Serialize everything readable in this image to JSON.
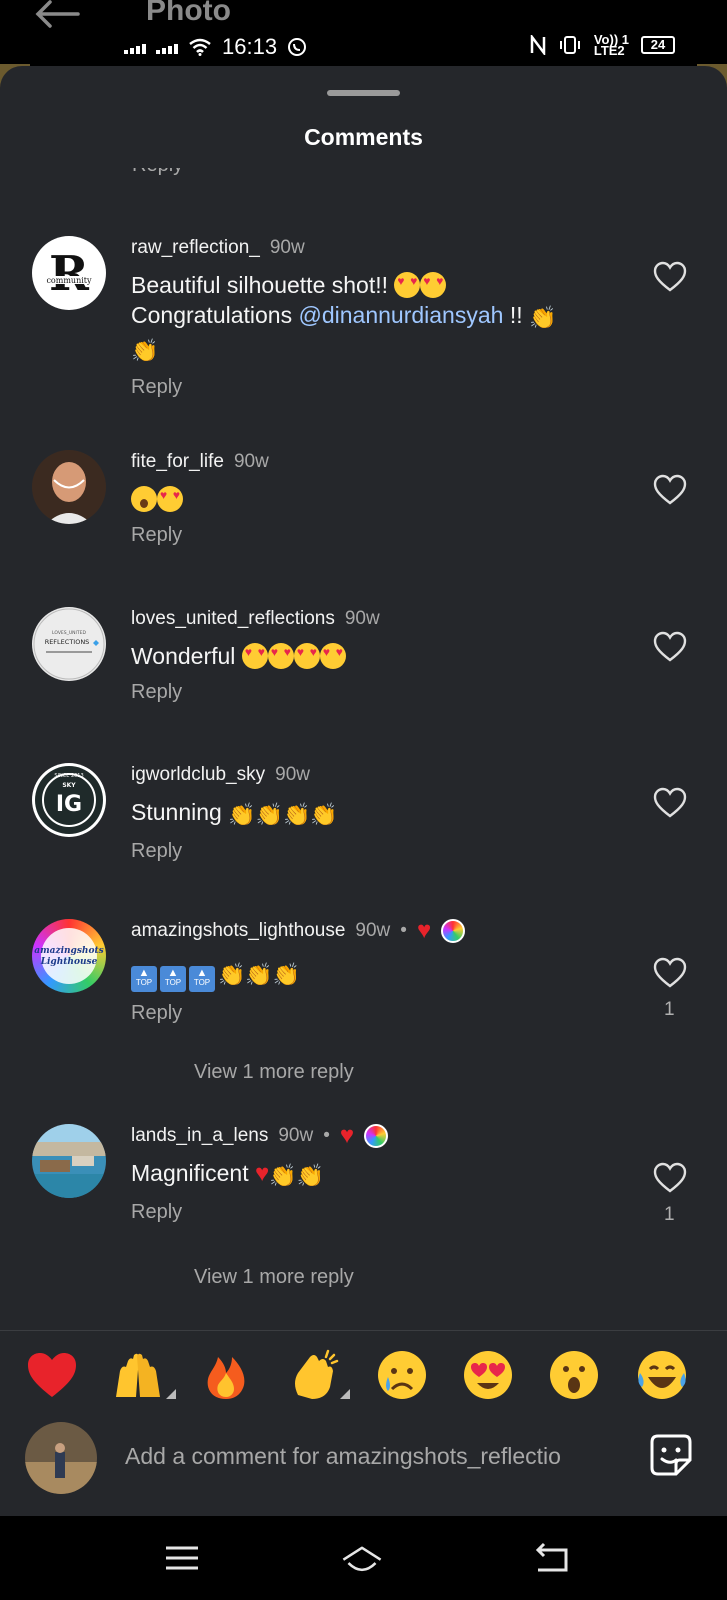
{
  "status_bar": {
    "header_title": "Photo",
    "time": "16:13",
    "battery": "24",
    "network_label_top": "Vo)) 1",
    "network_label_bottom": "LTE2"
  },
  "sheet": {
    "title": "Comments",
    "cut_off_reply": "Reply"
  },
  "comments": [
    {
      "username": "raw_reflection_",
      "time": "90w",
      "text_line1": "Beautiful silhouette shot!!",
      "text_line2_prefix": "Congratulations",
      "mention": "@dinannurdiansyah",
      "text_line2_suffix": "!!",
      "reply": "Reply"
    },
    {
      "username": "fite_for_life",
      "time": "90w",
      "reply": "Reply"
    },
    {
      "username": "loves_united_reflections",
      "time": "90w",
      "text": "Wonderful",
      "reply": "Reply"
    },
    {
      "username": "igworldclub_sky",
      "time": "90w",
      "text": "Stunning",
      "reply": "Reply"
    },
    {
      "username": "amazingshots_lighthouse",
      "time": "90w",
      "dot": "•",
      "reply": "Reply",
      "likes": "1",
      "view_more": "View 1 more reply",
      "badge_label": "TOP"
    },
    {
      "username": "lands_in_a_lens",
      "time": "90w",
      "dot": "•",
      "text": "Magnificent",
      "reply": "Reply",
      "likes": "1",
      "view_more": "View 1 more reply"
    }
  ],
  "avatar_labels": {
    "raw_letter": "R",
    "raw_word": "community",
    "loves_small": "LOVES_UNITED",
    "loves_big": "REFLECTIONS",
    "ig_top": "SINCE 2013",
    "ig_sky": "SKY",
    "ig_letters": "IG",
    "amazing_line1": "amazingshots",
    "amazing_line2": "Lighthouse"
  },
  "reactions": [
    "heart",
    "raised-hands",
    "fire",
    "clapping-hands",
    "crying-face",
    "heart-eyes-face",
    "astonished-face",
    "tears-of-joy-face"
  ],
  "input": {
    "placeholder": "Add a comment for amazingshots_reflectio"
  },
  "colors": {
    "sheet_bg": "#25272b",
    "mention": "#9fc7ff",
    "secondary_text": "#a8a8a8",
    "like_red": "#e8232b"
  }
}
